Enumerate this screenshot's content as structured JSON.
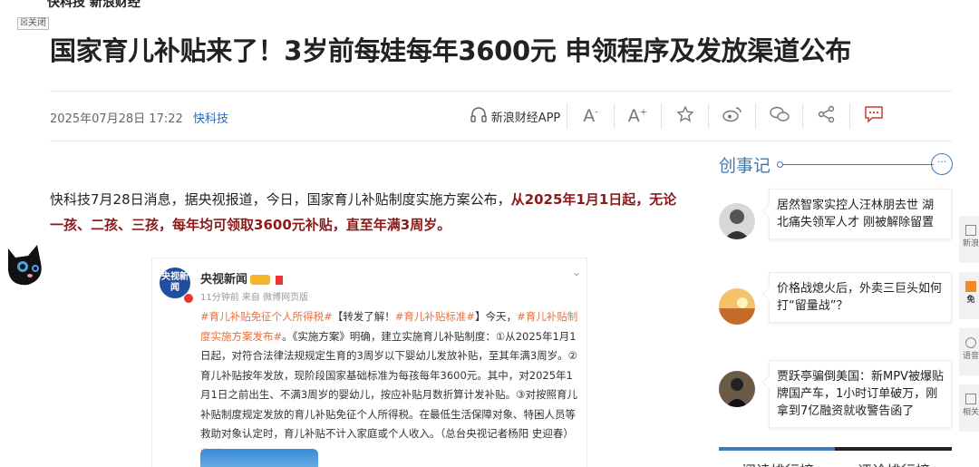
{
  "article": {
    "top_cut_text": "快科技 新浪财经",
    "close_label": "关闭",
    "title": "国家育儿补贴来了！3岁前每娃每年3600元 申领程序及发放渠道公布",
    "date": "2025年07月28日 17:22",
    "source": "快科技",
    "lead_normal": "快科技7月28日消息，据央视报道，今日，国家育儿补贴制度实施方案公布，",
    "lead_strong": "从2025年1月1日起，无论一孩、二孩、三孩，每年均可领取3600元补贴，直至年满3周岁。"
  },
  "toolbar": {
    "app_label": "新浪财经APP",
    "font_decrease": "A",
    "font_increase": "A"
  },
  "weibo": {
    "avatar_text": "央视新闻",
    "account": "央视新闻",
    "time": "11分钟前 来自 微博网页版",
    "text": "#育儿补贴免征个人所得税#【转发了解！#育儿补贴标准#】今天，#育儿补贴制度实施方案发布#。《实施方案》明确，建立实施育儿补贴制度：①从2025年1月1日起，对符合法律法规规定生育的3周岁以下婴幼儿发放补贴，至其年满3周岁。②育儿补贴按年发放，现阶段国家基础标准为每孩每年3600元。其中，对2025年1月1日之前出生、不满3周岁的婴幼儿，按应补贴月数折算计发补贴。③对按照育儿补贴制度规定发放的育儿补贴免征个人所得税。在最低生活保障对象、特困人员等救助对象认定时，育儿补贴不计入家庭或个人收入。（总台央视记者杨阳 史迎春）",
    "tag_1": "#育儿补贴免征个人所得税#",
    "body_1": "【转发了解！",
    "tag_2": "#育儿补贴标准#",
    "body_2": "】今天，",
    "tag_3": "#育儿补贴制度实施方案发布#",
    "body_3": "。《实施方案》明确，建立实施育儿补贴制度：①从2025年1月1日起，对符合法律法规规定生育的3周岁以下婴幼儿发放补贴，至其年满3周岁。②育儿补贴按年发放，现阶段国家基础标准为每孩每年3600元。其中，对2025年1月1日之前出生、不满3周岁的婴幼儿，按应补贴月数折算计发补贴。③对按照育儿补贴制度规定发放的育儿补贴免征个人所得税。在最低生活保障对象、特困人员等救助对象认定时，育儿补贴不计入家庭或个人收入。（总台央视记者杨阳 史迎春）",
    "fold_label": "收起"
  },
  "sidebar": {
    "section_title": "创事记",
    "more_label": "···",
    "cards": [
      {
        "text": "居然智家实控人汪林朋去世 湖北痛失领军人才 刚被解除留置"
      },
      {
        "text": "价格战熄火后，外卖三巨头如何打“留量战”？"
      },
      {
        "text": "贾跃亭骗倒美国：新MPV被爆贴牌国产车，1小时订单破万，刚拿到7亿融资就收警告函了"
      }
    ],
    "rank_tab_1": "阅读排行榜",
    "rank_tab_2": "评论排行榜"
  },
  "rail": {
    "items": [
      "新浪",
      "免",
      "语音",
      "相关"
    ]
  },
  "colors": {
    "link_blue": "#2a6ab5",
    "accent_blue": "#3c7ab8",
    "strong_red": "#8b1a1a",
    "tag_orange": "#e9703e",
    "comment_red": "#d23a2a"
  }
}
